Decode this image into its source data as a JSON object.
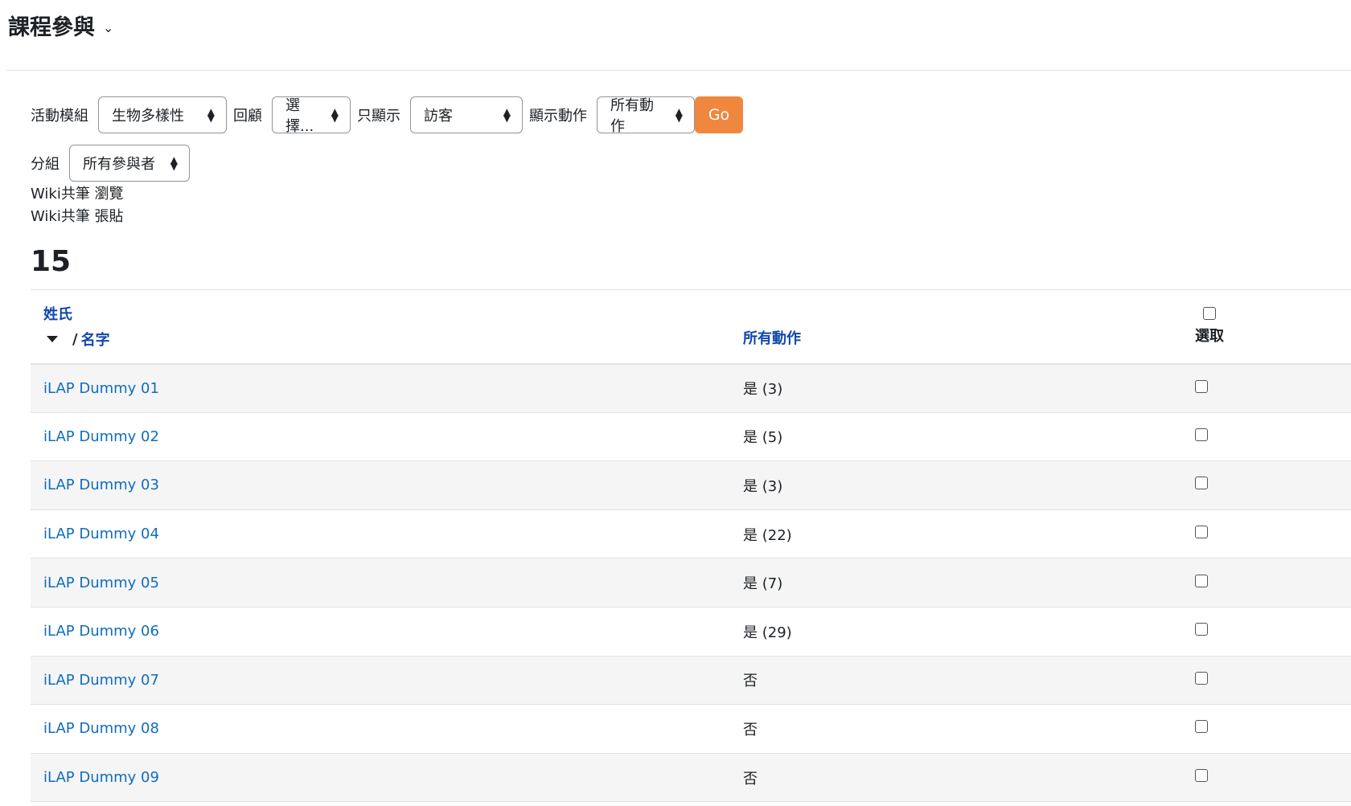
{
  "header": {
    "title": "課程參與",
    "menu_icon": "chevron-down-icon"
  },
  "filters": {
    "activity_label": "活動模組",
    "activity_value": "生物多樣性",
    "lookback_label": "回顧",
    "lookback_value": "選擇...",
    "show_only_label": "只顯示",
    "show_only_value": "訪客",
    "show_actions_label": "顯示動作",
    "show_actions_value": "所有動作",
    "go_label": "Go",
    "group_label": "分組",
    "group_value": "所有參與者"
  },
  "actions": [
    "Wiki共筆 瀏覽",
    "Wiki共筆 張貼"
  ],
  "count": "15",
  "table": {
    "col_lastname": "姓氏",
    "col_firstname": "名字",
    "col_actions": "所有動作",
    "col_select": "選取",
    "rows": [
      {
        "name": "iLAP Dummy 01",
        "actions": "是 (3)"
      },
      {
        "name": "iLAP Dummy 02",
        "actions": "是 (5)"
      },
      {
        "name": "iLAP Dummy 03",
        "actions": "是 (3)"
      },
      {
        "name": "iLAP Dummy 04",
        "actions": "是 (22)"
      },
      {
        "name": "iLAP Dummy 05",
        "actions": "是 (7)"
      },
      {
        "name": "iLAP Dummy 06",
        "actions": "是 (29)"
      },
      {
        "name": "iLAP Dummy 07",
        "actions": "否"
      },
      {
        "name": "iLAP Dummy 08",
        "actions": "否"
      },
      {
        "name": "iLAP Dummy 09",
        "actions": "否"
      }
    ]
  },
  "colors": {
    "link": "#0f6cbf",
    "header_link": "#0f47ad",
    "go_button": "#f0873e",
    "stripe": "#f5f5f5"
  }
}
